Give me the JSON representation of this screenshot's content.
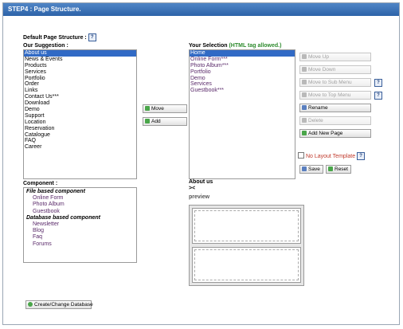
{
  "window": {
    "title": "STEP4 : Page Structure."
  },
  "default_structure_label": "Default Page Structure :",
  "help_glyph": "?",
  "suggestion": {
    "label": "Our Suggestion :",
    "items": [
      "About us",
      "News & Events",
      "Products",
      "Services",
      "Portfolio",
      "Order",
      "Links",
      "Contact Us***",
      "Download",
      "Demo",
      "Support",
      "Location",
      "Reservation",
      "Catalogue",
      "FAQ",
      "Career"
    ],
    "selected": "About us"
  },
  "selection": {
    "label": "Your Selection",
    "note": "(HTML tag allowed.)",
    "items": [
      "Home",
      "Online Form***",
      "Photo Album***",
      "Portfolio",
      "Demo",
      "Services",
      "Guestbook***"
    ],
    "selected": "Home"
  },
  "middle_buttons": {
    "move": "Move",
    "add": "Add"
  },
  "right_buttons": {
    "move_up": "Move Up",
    "move_down": "Move Down",
    "move_to_sub": "Move to Sub Menu",
    "move_to_top": "Move to Top Menu",
    "rename": "Rename",
    "delete": "Delete",
    "add_new_page": "Add New Page"
  },
  "no_layout_template": "No Layout Template",
  "save": "Save",
  "reset": "Reset",
  "component": {
    "label": "Component :",
    "file_based_header": "File based component",
    "file_based": [
      "Online Form",
      "Photo Album",
      "Guestbook"
    ],
    "db_based_header": "Database based component",
    "db_based": [
      "Newsletter",
      "Blog",
      "Faq",
      "Forums"
    ]
  },
  "about": {
    "title": "About us",
    "symbol": "><"
  },
  "preview_label": "preview",
  "create_db_button": "Create/Change Database",
  "colors": {
    "titlebar": "#2d63a8",
    "selected": "#316ac5",
    "note": "#2e8b2e",
    "warning": "#c0392b"
  }
}
